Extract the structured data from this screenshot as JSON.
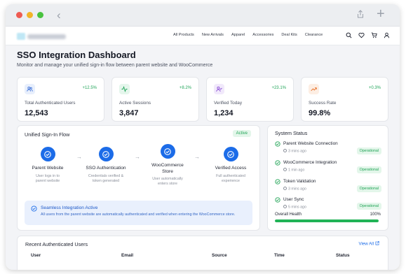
{
  "nav": {
    "links": [
      "All Products",
      "New Arrivals",
      "Apparel",
      "Accessories",
      "Deal Kits",
      "Clearance"
    ],
    "icons": [
      "search-icon",
      "heart-icon",
      "cart-icon",
      "user-icon"
    ]
  },
  "page": {
    "title": "SSO Integration Dashboard",
    "subtitle": "Monitor and manage your unified sign-in flow between parent website and WooCommerce"
  },
  "stats": [
    {
      "label": "Total Authenticated Users",
      "value": "12,543",
      "change": "+12.5%",
      "icon": "users-icon",
      "color": "#3b6fd8",
      "bg": "#e8effc"
    },
    {
      "label": "Active Sessions",
      "value": "3,847",
      "change": "+8.2%",
      "icon": "activity-icon",
      "color": "#22a55a",
      "bg": "#e5f6ec"
    },
    {
      "label": "Verified Today",
      "value": "1,234",
      "change": "+23.1%",
      "icon": "user-check-icon",
      "color": "#8b4fd6",
      "bg": "#f1e9fb"
    },
    {
      "label": "Success Rate",
      "value": "99.8%",
      "change": "+0.3%",
      "icon": "trending-up-icon",
      "color": "#e8732c",
      "bg": "#fdeee3"
    }
  ],
  "flow": {
    "title": "Unified Sign-In Flow",
    "badge": "Active",
    "steps": [
      {
        "title": "Parent Website",
        "desc": "User logs in to parent website"
      },
      {
        "title": "SSO Authentication",
        "desc": "Credentials verified & token generated"
      },
      {
        "title": "WooCommerce Store",
        "desc": "User automatically enters store"
      },
      {
        "title": "Verified Access",
        "desc": "Full authenticated experience"
      }
    ],
    "notice_title": "Seamless Integration Active",
    "notice_body": "All users from the parent website are automatically authenticated and verified when entering the WooCommerce store."
  },
  "status": {
    "title": "System Status",
    "items": [
      {
        "name": "Parent Website Connection",
        "time": "3 mins ago",
        "badge": "Operational"
      },
      {
        "name": "WooCommerce Integration",
        "time": "1 min ago",
        "badge": "Operational"
      },
      {
        "name": "Token Validation",
        "time": "3 mins ago",
        "badge": "Operational"
      },
      {
        "name": "User Sync",
        "time": "5 mins ago",
        "badge": "Operational"
      }
    ],
    "health_label": "Overall Health",
    "health_value": "100%",
    "health_fraction": 1.0
  },
  "recent": {
    "title": "Recent Authenticated Users",
    "view_all": "View All",
    "columns": [
      "User",
      "Email",
      "Source",
      "Time",
      "Status"
    ]
  },
  "colors": {
    "accent": "#1c6ce8",
    "success": "#21a456"
  }
}
